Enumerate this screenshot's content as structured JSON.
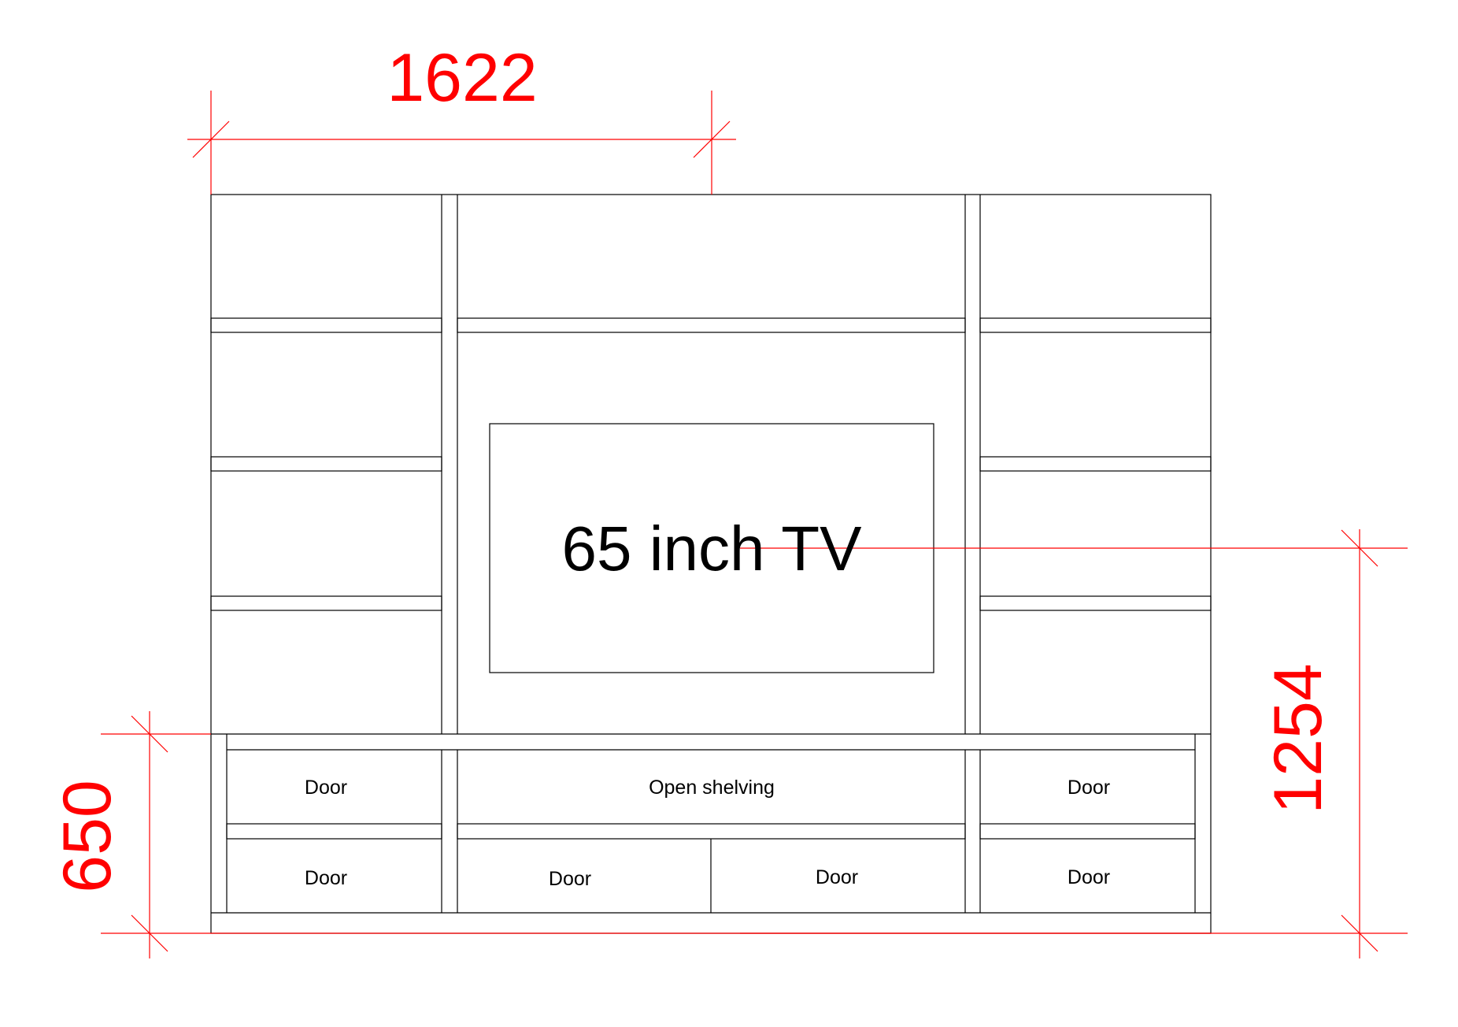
{
  "colors": {
    "outline": "#000000",
    "dimension": "#ff0000",
    "background": "#ffffff"
  },
  "tv": {
    "label": "65 inch TV"
  },
  "dimensions": {
    "width_total": "1622",
    "height_total": "1254",
    "height_base": "650"
  },
  "base_cabinet": {
    "upper_left": "Door",
    "upper_center": "Open shelving",
    "upper_right": "Door",
    "lower_left": "Door",
    "lower_center_left": "Door",
    "lower_center_right": "Door",
    "lower_right": "Door"
  }
}
